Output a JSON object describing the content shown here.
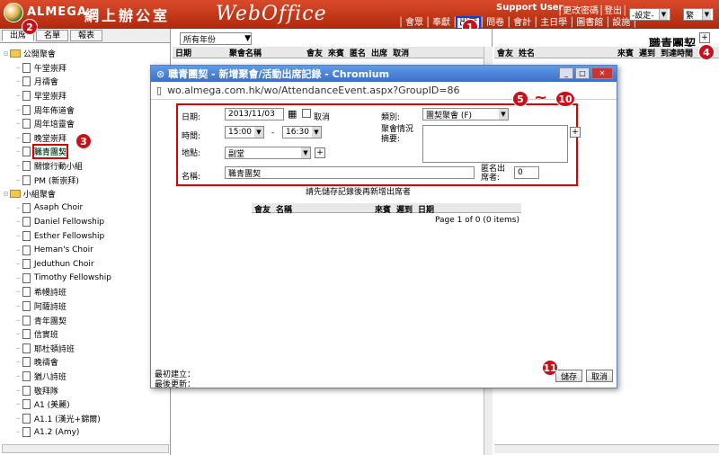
{
  "header": {
    "brand": "ALMEGA",
    "brand_cn": "網上辦公室",
    "brand_wo": "WebOffice",
    "user": "Support User",
    "links_a": [
      "更改密碼",
      "登出"
    ],
    "links_b": [
      "會眾",
      "奉獻",
      "出席",
      "問卷",
      "會計",
      "主日學",
      "圖書館",
      "設施"
    ],
    "settings_label": "-設定-",
    "lang_label": "繁"
  },
  "left": {
    "tabs": [
      "出席",
      "名單",
      "報表"
    ],
    "tree": [
      {
        "label": "公開聚會",
        "type": "folder",
        "depth": 0
      },
      {
        "label": "午堂崇拜",
        "type": "page",
        "depth": 1
      },
      {
        "label": "月禱會",
        "type": "page",
        "depth": 1
      },
      {
        "label": "早堂崇拜",
        "type": "page",
        "depth": 1
      },
      {
        "label": "周年佈道會",
        "type": "page",
        "depth": 1
      },
      {
        "label": "周年培靈會",
        "type": "page",
        "depth": 1
      },
      {
        "label": "晚堂崇拜",
        "type": "page",
        "depth": 1
      },
      {
        "label": "職青團契",
        "type": "page",
        "depth": 1,
        "selected": true
      },
      {
        "label": "關懷行動小組",
        "type": "page",
        "depth": 1
      },
      {
        "label": "PM (新崇拜)",
        "type": "page",
        "depth": 1
      },
      {
        "label": "小組聚會",
        "type": "folder",
        "depth": 0
      },
      {
        "label": "Asaph Choir",
        "type": "page",
        "depth": 1
      },
      {
        "label": "Daniel Fellowship",
        "type": "page",
        "depth": 1
      },
      {
        "label": "Esther Fellowship",
        "type": "page",
        "depth": 1
      },
      {
        "label": "Heman's Choir",
        "type": "page",
        "depth": 1
      },
      {
        "label": "Jeduthun Choir",
        "type": "page",
        "depth": 1
      },
      {
        "label": "Timothy Fellowship",
        "type": "page",
        "depth": 1
      },
      {
        "label": "希幔詩班",
        "type": "page",
        "depth": 1
      },
      {
        "label": "阿薩詩班",
        "type": "page",
        "depth": 1
      },
      {
        "label": "青年團契",
        "type": "page",
        "depth": 1
      },
      {
        "label": "信實班",
        "type": "page",
        "depth": 1
      },
      {
        "label": "耶杜頓詩班",
        "type": "page",
        "depth": 1
      },
      {
        "label": "晚禱會",
        "type": "page",
        "depth": 1
      },
      {
        "label": "猶八詩班",
        "type": "page",
        "depth": 1
      },
      {
        "label": "敬拜隊",
        "type": "page",
        "depth": 1
      },
      {
        "label": "A1 (美麗)",
        "type": "page",
        "depth": 1
      },
      {
        "label": "A1.1 (漢光+錦爾)",
        "type": "page",
        "depth": 1
      },
      {
        "label": "A1.2 (Amy)",
        "type": "page",
        "depth": 1
      }
    ]
  },
  "middle": {
    "year_filter": "所有年份",
    "headers": [
      "日期",
      "聚會名稱",
      "會友",
      "來賓",
      "匿名",
      "出席",
      "取消"
    ]
  },
  "right": {
    "title": "職青團契",
    "headers": [
      "會友",
      "姓名",
      "來賓",
      "遲到",
      "到達時間"
    ]
  },
  "dialog": {
    "title": "職青團契 - 新增聚會/活動出席記錄 - Chromium",
    "url": "wo.almega.com.hk/wo/AttendanceEvent.aspx?GroupID=86",
    "date_label": "日期:",
    "date_value": "2013/11/03",
    "cancel_check_label": "取消",
    "time_label": "時間:",
    "time_from": "15:00",
    "time_sep": "-",
    "time_to": "16:30",
    "location_label": "地點:",
    "location_value": "副堂",
    "category_label": "類別:",
    "category_value": "團契聚會 (F)",
    "summary_label": "聚會情況摘要:",
    "name_label": "名稱:",
    "name_value": "職青團契",
    "anon_label": "匿名出席者:",
    "anon_value": "0",
    "hint": "請先儲存記錄後再新增出席者",
    "table_headers": [
      "會友",
      "名稱",
      "來賓",
      "遲到",
      "日期"
    ],
    "pager": "Page 1 of 0 (0 items)",
    "created_label": "最初建立：",
    "updated_label": "最後更新：",
    "save_label": "儲存",
    "cancel_label": "取消"
  },
  "callouts": [
    "1",
    "2",
    "3",
    "4",
    "5",
    "~",
    "10",
    "11"
  ],
  "colors": {
    "header_red": "#c0391b",
    "callout_red": "#c8101a",
    "dialog_blue": "#3c6fc4"
  }
}
